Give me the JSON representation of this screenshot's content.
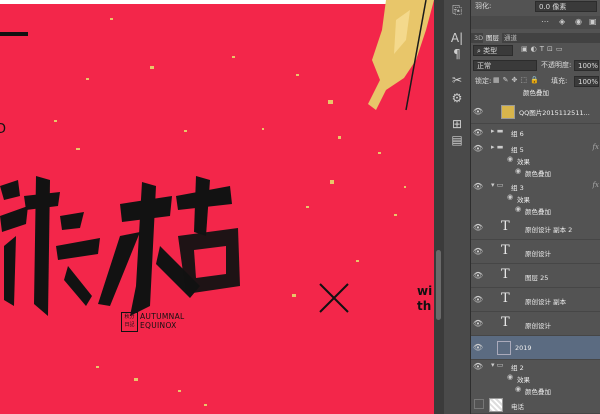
{
  "canvas": {
    "partial_letter": "D",
    "english": [
      "AUTUMNAL",
      "EQUINOX"
    ],
    "seal_text": "秋分\n日記",
    "cut_text": [
      "wi",
      "th"
    ],
    "colors": {
      "background": "#f3264a",
      "ink": "#111111",
      "gold": "#e8c66a"
    }
  },
  "panel": {
    "feather_label": "羽化:",
    "feather_value": "0.0 像素",
    "tabs": [
      "3D",
      "图层",
      "通道"
    ],
    "kind_label": "类型",
    "blend_mode": "正常",
    "opacity_label": "不透明度:",
    "opacity_value": "100%",
    "lock_label": "锁定:",
    "fill_label": "填充:",
    "fill_value": "100%",
    "partial_top": "颜色叠加",
    "layers": [
      {
        "type": "image",
        "name": "QQ图片2015112511..."
      },
      {
        "type": "group",
        "name": "组 6",
        "open": false
      },
      {
        "type": "group",
        "name": "组 5",
        "open": false,
        "fx": "fx"
      },
      {
        "type": "effect",
        "name": "效果"
      },
      {
        "type": "effect2",
        "name": "颜色叠加"
      },
      {
        "type": "group",
        "name": "组 3",
        "open": true,
        "fx": "fx"
      },
      {
        "type": "effect",
        "name": "效果"
      },
      {
        "type": "effect2",
        "name": "颜色叠加"
      },
      {
        "type": "text",
        "name": "原创设计 副本 2"
      },
      {
        "type": "text",
        "name": "原创设计"
      },
      {
        "type": "text",
        "name": "图层 25"
      },
      {
        "type": "text",
        "name": "原创设计 副本"
      },
      {
        "type": "text",
        "name": "原创设计"
      },
      {
        "type": "smart",
        "name": "2019",
        "selected": true
      },
      {
        "type": "group",
        "name": "组 2",
        "open": true
      },
      {
        "type": "effect",
        "name": "效果"
      },
      {
        "type": "effect2",
        "name": "颜色叠加"
      },
      {
        "type": "image",
        "name": "电话",
        "hidden": true
      }
    ],
    "fx_label": "fx"
  }
}
